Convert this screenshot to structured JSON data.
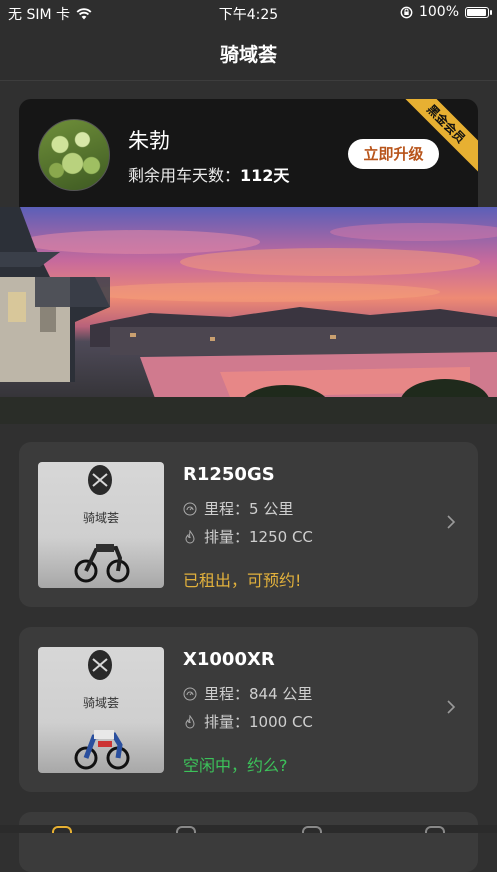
{
  "status_bar": {
    "carrier": "无 SIM 卡",
    "time": "下午4:25",
    "battery": "100%",
    "battery_level": 1.0
  },
  "nav": {
    "title": "骑域荟"
  },
  "member": {
    "name": "朱勃",
    "days_label": "剩余用车天数：",
    "days_value": "112天",
    "upgrade_label": "立即升级",
    "badge": "黑金会员"
  },
  "bikes": [
    {
      "name": "R1250GS",
      "mileage_label": "里程：",
      "mileage": "5 公里",
      "displacement_label": "排量：",
      "displacement": "1250 CC",
      "status": "已租出，可预约!",
      "status_color": "#e2b13c",
      "thumb_text": "骑域荟"
    },
    {
      "name": "X1000XR",
      "mileage_label": "里程：",
      "mileage": "844 公里",
      "displacement_label": "排量：",
      "displacement": "1000 CC",
      "status": "空闲中，约么?",
      "status_color": "#3cc25a",
      "thumb_text": "骑域荟"
    }
  ],
  "colors": {
    "background": "#303030",
    "card": "#3b3b3b",
    "member_card": "#161616",
    "badge": "#e7b032",
    "upgrade_text": "#b8541a"
  }
}
